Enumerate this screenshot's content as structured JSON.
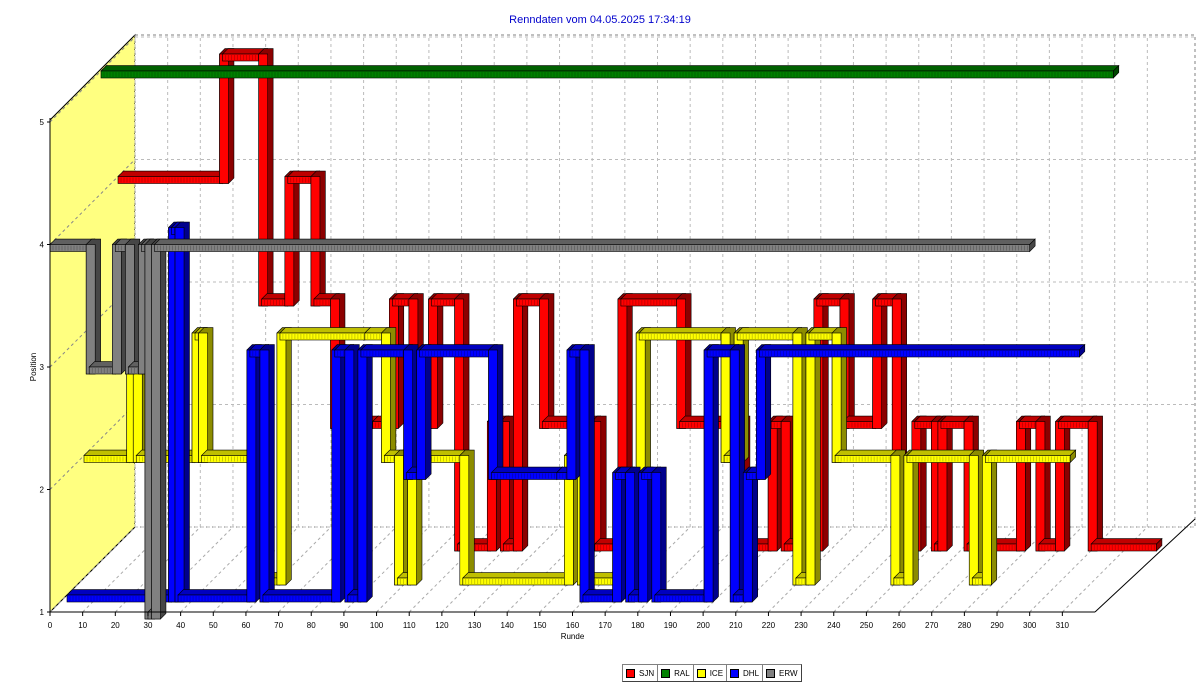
{
  "title": "Renndaten vom 04.05.2025 17:34:19",
  "legend": [
    {
      "label": "SJN",
      "color": "#ff0000"
    },
    {
      "label": "RAL",
      "color": "#008000"
    },
    {
      "label": "ICE",
      "color": "#ffff00"
    },
    {
      "label": "DHL",
      "color": "#0000ff"
    },
    {
      "label": "ERW",
      "color": "#808080"
    }
  ],
  "chart_data": {
    "type": "line",
    "style": "3d-step",
    "title": "Renndaten vom 04.05.2025 17:34:19",
    "xlabel": "Runde",
    "ylabel": "Position",
    "xlim": [
      0,
      320
    ],
    "ylim": [
      1,
      5.9
    ],
    "x_ticks": [
      0,
      10,
      20,
      30,
      40,
      50,
      60,
      70,
      80,
      90,
      100,
      110,
      120,
      130,
      140,
      150,
      160,
      170,
      180,
      190,
      200,
      210,
      220,
      230,
      240,
      250,
      260,
      270,
      280,
      290,
      300,
      310
    ],
    "y_ticks": [
      1,
      2,
      3,
      4,
      5
    ],
    "grid": true,
    "legend_position": "bottom-center",
    "series": [
      {
        "name": "SJN",
        "color": "#ff0000",
        "depth": 0,
        "steps": [
          {
            "x": 0,
            "y": 4
          },
          {
            "x": 32,
            "y": 5
          },
          {
            "x": 44,
            "y": 3
          },
          {
            "x": 52,
            "y": 4
          },
          {
            "x": 60,
            "y": 3
          },
          {
            "x": 66,
            "y": 2
          },
          {
            "x": 78,
            "y": 2
          },
          {
            "x": 84,
            "y": 3
          },
          {
            "x": 90,
            "y": 2
          },
          {
            "x": 96,
            "y": 3
          },
          {
            "x": 104,
            "y": 1
          },
          {
            "x": 114,
            "y": 2
          },
          {
            "x": 118,
            "y": 1
          },
          {
            "x": 122,
            "y": 3
          },
          {
            "x": 130,
            "y": 2
          },
          {
            "x": 146,
            "y": 1
          },
          {
            "x": 154,
            "y": 3
          },
          {
            "x": 172,
            "y": 2
          },
          {
            "x": 190,
            "y": 1
          },
          {
            "x": 200,
            "y": 2
          },
          {
            "x": 204,
            "y": 1
          },
          {
            "x": 214,
            "y": 3
          },
          {
            "x": 222,
            "y": 2
          },
          {
            "x": 232,
            "y": 3
          },
          {
            "x": 238,
            "y": 1
          },
          {
            "x": 244,
            "y": 2
          },
          {
            "x": 250,
            "y": 1
          },
          {
            "x": 252,
            "y": 2
          },
          {
            "x": 260,
            "y": 1
          },
          {
            "x": 276,
            "y": 2
          },
          {
            "x": 282,
            "y": 1
          },
          {
            "x": 288,
            "y": 2
          },
          {
            "x": 298,
            "y": 1
          },
          {
            "x": 318,
            "y": 1
          }
        ]
      },
      {
        "name": "RAL",
        "color": "#008000",
        "depth": 1,
        "steps": [
          {
            "x": 0,
            "y": 5
          },
          {
            "x": 310,
            "y": 5
          }
        ]
      },
      {
        "name": "ICE",
        "color": "#ffff00",
        "depth": 2,
        "steps": [
          {
            "x": 0,
            "y": 2
          },
          {
            "x": 14,
            "y": 3
          },
          {
            "x": 16,
            "y": 2
          },
          {
            "x": 34,
            "y": 3
          },
          {
            "x": 36,
            "y": 2
          },
          {
            "x": 54,
            "y": 1
          },
          {
            "x": 60,
            "y": 3
          },
          {
            "x": 86,
            "y": 3
          },
          {
            "x": 92,
            "y": 2
          },
          {
            "x": 96,
            "y": 1
          },
          {
            "x": 100,
            "y": 2
          },
          {
            "x": 116,
            "y": 1
          },
          {
            "x": 148,
            "y": 2
          },
          {
            "x": 152,
            "y": 1
          },
          {
            "x": 170,
            "y": 3
          },
          {
            "x": 196,
            "y": 2
          },
          {
            "x": 200,
            "y": 3
          },
          {
            "x": 218,
            "y": 1
          },
          {
            "x": 222,
            "y": 3
          },
          {
            "x": 230,
            "y": 2
          },
          {
            "x": 248,
            "y": 1
          },
          {
            "x": 252,
            "y": 2
          },
          {
            "x": 272,
            "y": 1
          },
          {
            "x": 276,
            "y": 2
          },
          {
            "x": 302,
            "y": 2
          }
        ]
      },
      {
        "name": "DHL",
        "color": "#0000ff",
        "depth": 3,
        "steps": [
          {
            "x": 0,
            "y": 1
          },
          {
            "x": 32,
            "y": 4
          },
          {
            "x": 34,
            "y": 1
          },
          {
            "x": 56,
            "y": 3
          },
          {
            "x": 60,
            "y": 1
          },
          {
            "x": 82,
            "y": 3
          },
          {
            "x": 86,
            "y": 1
          },
          {
            "x": 90,
            "y": 3
          },
          {
            "x": 104,
            "y": 2
          },
          {
            "x": 108,
            "y": 3
          },
          {
            "x": 130,
            "y": 2
          },
          {
            "x": 150,
            "y": 2
          },
          {
            "x": 154,
            "y": 3
          },
          {
            "x": 158,
            "y": 1
          },
          {
            "x": 168,
            "y": 2
          },
          {
            "x": 172,
            "y": 1
          },
          {
            "x": 176,
            "y": 2
          },
          {
            "x": 180,
            "y": 1
          },
          {
            "x": 196,
            "y": 3
          },
          {
            "x": 204,
            "y": 1
          },
          {
            "x": 208,
            "y": 2
          },
          {
            "x": 212,
            "y": 3
          },
          {
            "x": 310,
            "y": 3
          }
        ]
      },
      {
        "name": "ERW",
        "color": "#808080",
        "depth": 4,
        "steps": [
          {
            "x": 0,
            "y": 4
          },
          {
            "x": 12,
            "y": 3
          },
          {
            "x": 20,
            "y": 4
          },
          {
            "x": 24,
            "y": 3
          },
          {
            "x": 28,
            "y": 4
          },
          {
            "x": 30,
            "y": 1
          },
          {
            "x": 32,
            "y": 4
          },
          {
            "x": 300,
            "y": 4
          }
        ]
      }
    ]
  }
}
